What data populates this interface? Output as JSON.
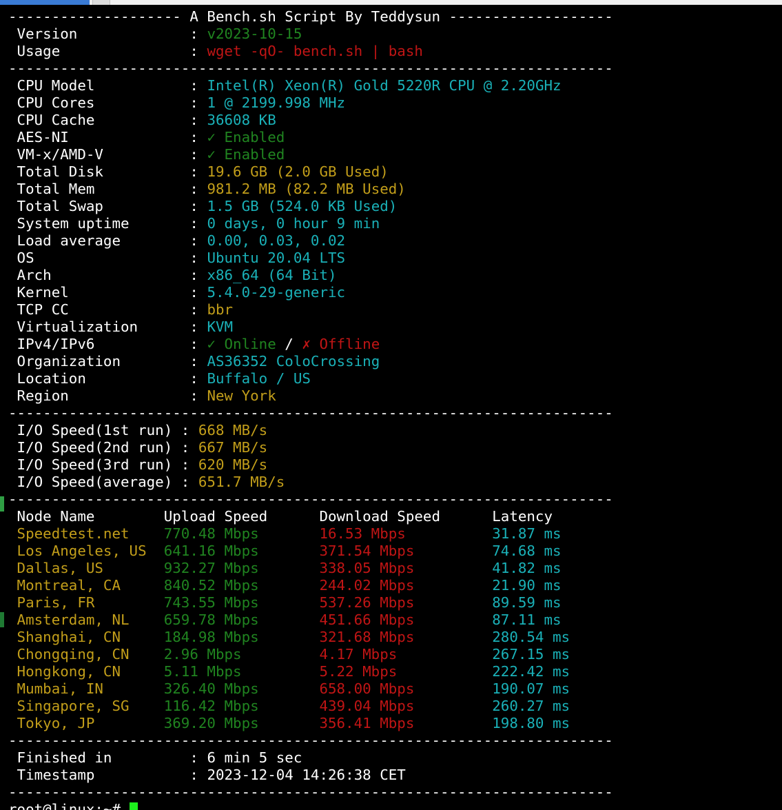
{
  "header": {
    "title_line": "-------------------- A Bench.sh Script By Teddysun -------------------"
  },
  "separator": "----------------------------------------------------------------------",
  "meta": [
    {
      "label": "Version",
      "value": "v2023-10-15",
      "color": "green"
    },
    {
      "label": "Usage",
      "value": "wget -qO- bench.sh | bash",
      "color": "red"
    }
  ],
  "system": [
    {
      "label": "CPU Model",
      "value": "Intel(R) Xeon(R) Gold 5220R CPU @ 2.20GHz",
      "color": "cyan"
    },
    {
      "label": "CPU Cores",
      "value": "1 @ 2199.998 MHz",
      "color": "cyan"
    },
    {
      "label": "CPU Cache",
      "value": "36608 KB",
      "color": "cyan"
    },
    {
      "label": "AES-NI",
      "value": "✓ Enabled",
      "color": "green"
    },
    {
      "label": "VM-x/AMD-V",
      "value": "✓ Enabled",
      "color": "green"
    },
    {
      "label": "Total Disk",
      "value": "19.6 GB (2.0 GB Used)",
      "color": "yellow"
    },
    {
      "label": "Total Mem",
      "value": "981.2 MB (82.2 MB Used)",
      "color": "yellow"
    },
    {
      "label": "Total Swap",
      "value": "1.5 GB (524.0 KB Used)",
      "color": "cyan"
    },
    {
      "label": "System uptime",
      "value": "0 days, 0 hour 9 min",
      "color": "cyan"
    },
    {
      "label": "Load average",
      "value": "0.00, 0.03, 0.02",
      "color": "cyan"
    },
    {
      "label": "OS",
      "value": "Ubuntu 20.04 LTS",
      "color": "cyan"
    },
    {
      "label": "Arch",
      "value": "x86_64 (64 Bit)",
      "color": "cyan"
    },
    {
      "label": "Kernel",
      "value": "5.4.0-29-generic",
      "color": "cyan"
    },
    {
      "label": "TCP CC",
      "value": "bbr",
      "color": "yellow"
    },
    {
      "label": "Virtualization",
      "value": "KVM",
      "color": "cyan"
    }
  ],
  "ip": {
    "label": "IPv4/IPv6",
    "online": "✓ Online",
    "slash": " / ",
    "offline": "✗ Offline"
  },
  "network": [
    {
      "label": "Organization",
      "value": "AS36352 ColoCrossing",
      "color": "cyan"
    },
    {
      "label": "Location",
      "value": "Buffalo / US",
      "color": "cyan"
    },
    {
      "label": "Region",
      "value": "New York",
      "color": "yellow"
    }
  ],
  "io": [
    {
      "label": "I/O Speed(1st run)",
      "value": "668 MB/s"
    },
    {
      "label": "I/O Speed(2nd run)",
      "value": "667 MB/s"
    },
    {
      "label": "I/O Speed(3rd run)",
      "value": "620 MB/s"
    },
    {
      "label": "I/O Speed(average)",
      "value": "651.7 MB/s"
    }
  ],
  "speed_table": {
    "headers": [
      "Node Name",
      "Upload Speed",
      "Download Speed",
      "Latency"
    ],
    "rows": [
      [
        "Speedtest.net",
        "770.48 Mbps",
        "16.53 Mbps",
        "31.87 ms"
      ],
      [
        "Los Angeles, US",
        "641.16 Mbps",
        "371.54 Mbps",
        "74.68 ms"
      ],
      [
        "Dallas, US",
        "932.27 Mbps",
        "338.05 Mbps",
        "41.82 ms"
      ],
      [
        "Montreal, CA",
        "840.52 Mbps",
        "244.02 Mbps",
        "21.90 ms"
      ],
      [
        "Paris, FR",
        "743.55 Mbps",
        "537.26 Mbps",
        "89.59 ms"
      ],
      [
        "Amsterdam, NL",
        "659.78 Mbps",
        "451.66 Mbps",
        "87.11 ms"
      ],
      [
        "Shanghai, CN",
        "184.98 Mbps",
        "321.68 Mbps",
        "280.54 ms"
      ],
      [
        "Chongqing, CN",
        "2.96 Mbps",
        "4.17 Mbps",
        "267.15 ms"
      ],
      [
        "Hongkong, CN",
        "5.11 Mbps",
        "5.22 Mbps",
        "222.42 ms"
      ],
      [
        "Mumbai, IN",
        "326.40 Mbps",
        "658.00 Mbps",
        "190.07 ms"
      ],
      [
        "Singapore, SG",
        "116.42 Mbps",
        "439.04 Mbps",
        "260.27 ms"
      ],
      [
        "Tokyo, JP",
        "369.20 Mbps",
        "356.41 Mbps",
        "198.80 ms"
      ]
    ]
  },
  "footer": [
    {
      "label": "Finished in",
      "value": "6 min 5 sec"
    },
    {
      "label": "Timestamp",
      "value": "2023-12-04 14:26:38 CET"
    }
  ],
  "prompt": "root@linux:~# ",
  "colors": {
    "background": "#000000",
    "white": "#ffffff",
    "green": "#208420",
    "red": "#c01515",
    "cyan": "#1ab1b8",
    "yellow": "#c29e1a",
    "cursor": "#1df01d"
  }
}
